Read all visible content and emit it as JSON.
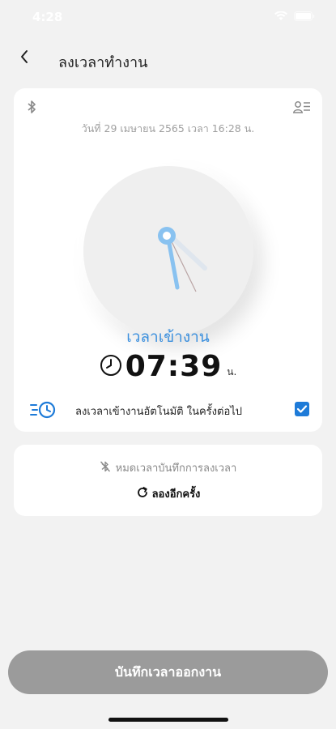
{
  "status_bar": {
    "time": "4:28"
  },
  "header": {
    "title": "ลงเวลาทำงาน"
  },
  "card": {
    "date_text": "วันที่ 29 เมษายน 2565 เวลา 16:28 น.",
    "mode_label": "เวลาเข้างาน",
    "time_value": "07:39",
    "time_unit": "น.",
    "auto_label": "ลงเวลาเข้างานอัตโนมัติ ในครั้งต่อไป",
    "auto_checked": true,
    "accent_color": "#3a8fde"
  },
  "card2": {
    "expired_text": "หมดเวลาบันทึกการลงเวลา",
    "retry_text": "ลองอีกครั้ง"
  },
  "bottom": {
    "clockout_label": "บันทึกเวลาออกงาน"
  },
  "icons": [
    "back-icon",
    "bluetooth-icon",
    "profile-list-icon",
    "clock-icon",
    "auto-clock-icon",
    "checkbox-checked-icon",
    "bluetooth-off-icon",
    "refresh-icon",
    "wifi-icon",
    "battery-icon"
  ]
}
